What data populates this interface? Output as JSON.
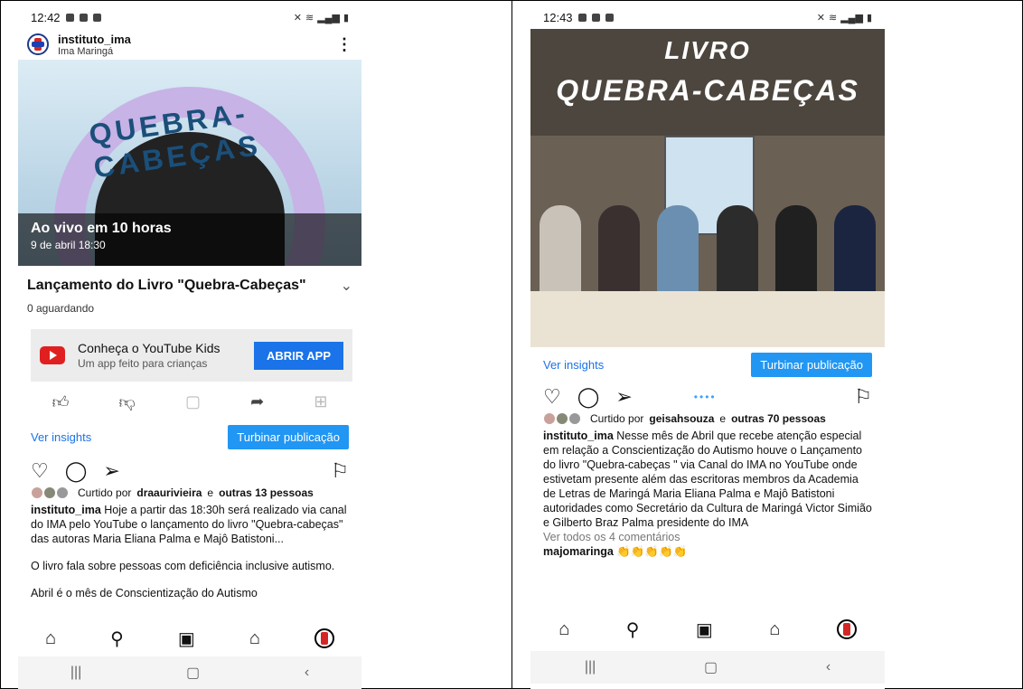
{
  "left": {
    "status_time": "12:42",
    "account": {
      "name": "instituto_ima",
      "location": "Ima Maringá"
    },
    "thumbnail": {
      "arc_text": "QUEBRA-CABEÇAS",
      "live_title": "Ao vivo em 10 horas",
      "live_date": "9 de abril 18:30"
    },
    "video_title": "Lançamento do Livro \"Quebra-Cabeças\"",
    "waiting": "0 aguardando",
    "kids": {
      "title": "Conheça o YouTube Kids",
      "subtitle": "Um app feito para crianças",
      "button": "ABRIR APP"
    },
    "insights_label": "Ver insights",
    "boost_label": "Turbinar publicação",
    "liked_prefix": "Curtido por",
    "liked_user": "draaurivieira",
    "liked_and": "e",
    "liked_others": "outras 13 pessoas",
    "caption_user": "instituto_ima",
    "caption_1": "Hoje a partir das 18:30h será realizado via canal do IMA pelo YouTube o lançamento do livro \"Quebra-cabeças\" das autoras Maria Eliana Palma e Majô Batistoni...",
    "caption_2": "O livro fala sobre pessoas com deficiência inclusive autismo.",
    "caption_3": "Abril é o mês de Conscientização do Autismo"
  },
  "right": {
    "status_time": "12:43",
    "hero_line1": "LIVRO",
    "hero_line2": "QUEBRA-CABEÇAS",
    "insights_label": "Ver insights",
    "boost_label": "Turbinar publicação",
    "liked_prefix": "Curtido por",
    "liked_user": "geisahsouza",
    "liked_and": "e",
    "liked_others": "outras 70 pessoas",
    "caption_user": "instituto_ima",
    "caption": "Nesse mês de Abril que recebe atenção especial em relação a Conscientização do Autismo houve o Lançamento do livro \"Quebra-cabeças \" via Canal do IMA no YouTube onde estivetam presente além das escritoras membros da Academia de Letras de Maringá Maria Eliana Palma e Majô Batistoni autoridades como Secretário da Cultura de Maringá Victor Simião e Gilberto Braz Palma presidente do IMA",
    "view_comments": "Ver todos os 4 comentários",
    "comment_user": "majomaringa",
    "comment_text": "👏👏👏👏👏"
  },
  "colors": {
    "accent": "#1a73e8",
    "boost": "#2196f3",
    "youtube_red": "#e02020"
  }
}
